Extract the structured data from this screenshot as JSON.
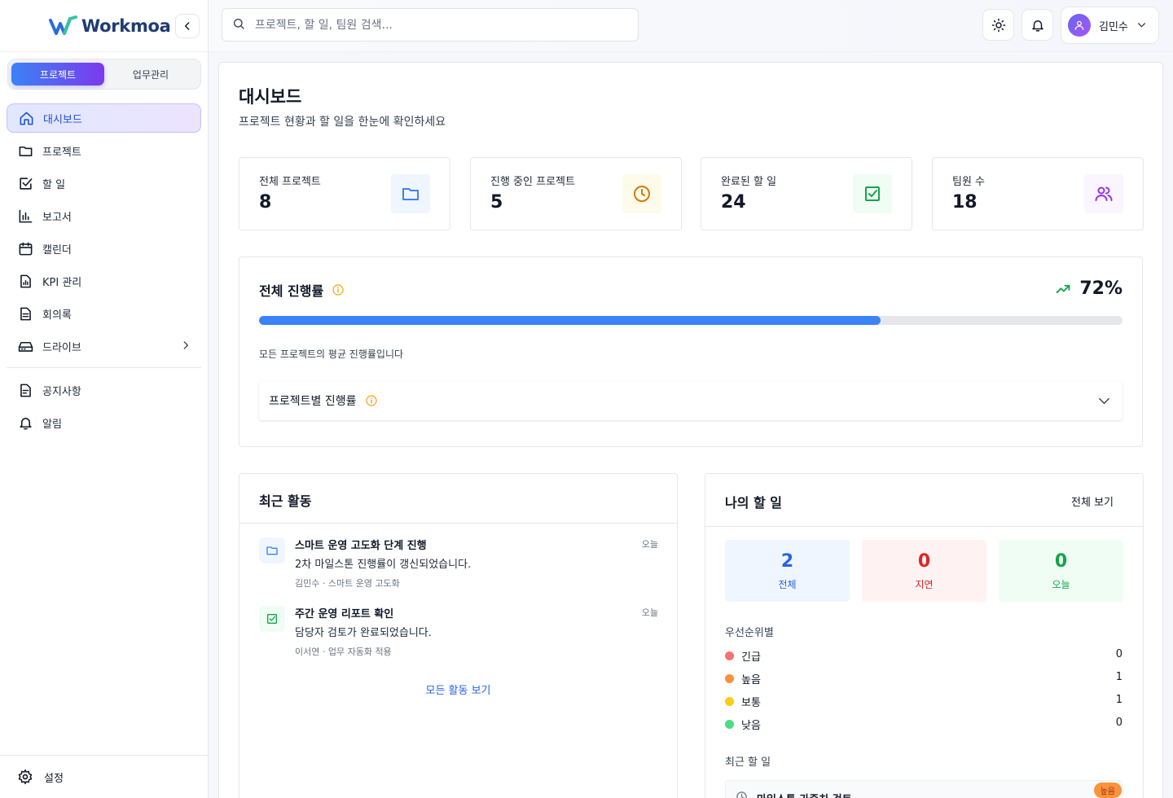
{
  "brand": {
    "name": "Workmoa"
  },
  "mode_toggle": {
    "project": "프로젝트",
    "work": "업무관리"
  },
  "nav": {
    "items": [
      {
        "label": "대시보드",
        "icon": "home-icon"
      },
      {
        "label": "프로젝트",
        "icon": "folder-icon"
      },
      {
        "label": "할 일",
        "icon": "checkbox-icon"
      },
      {
        "label": "보고서",
        "icon": "bar-chart-icon"
      },
      {
        "label": "캘린더",
        "icon": "calendar-icon"
      },
      {
        "label": "KPI 관리",
        "icon": "kpi-file-icon"
      },
      {
        "label": "회의록",
        "icon": "document-icon"
      },
      {
        "label": "드라이브",
        "icon": "drive-icon"
      }
    ],
    "secondary": [
      {
        "label": "공지사항",
        "icon": "notice-icon"
      },
      {
        "label": "알림",
        "icon": "bell-icon"
      }
    ],
    "settings": "설정"
  },
  "topbar": {
    "search_placeholder": "프로젝트, 할 일, 팀원 검색...",
    "user_name": "김민수"
  },
  "page": {
    "title": "대시보드",
    "subtitle": "프로젝트 현황과 할 일을 한눈에 확인하세요"
  },
  "stats": [
    {
      "label": "전체 프로젝트",
      "value": "8",
      "icon": "folder-icon",
      "color": "#3b82f6",
      "bg": "#eff6ff"
    },
    {
      "label": "진행 중인 프로젝트",
      "value": "5",
      "icon": "clock-icon",
      "color": "#d97706",
      "bg": "#fffbeb"
    },
    {
      "label": "완료된 할 일",
      "value": "24",
      "icon": "check-square-icon",
      "color": "#16a34a",
      "bg": "#f0fdf4"
    },
    {
      "label": "팀원 수",
      "value": "18",
      "icon": "users-icon",
      "color": "#9333ea",
      "bg": "#faf5ff"
    }
  ],
  "progress": {
    "title": "전체 진행률",
    "percent_label": "72%",
    "percent": 72,
    "description": "모든 프로젝트의 평균 진행률입니다",
    "accordion_title": "프로젝트별 진행률"
  },
  "activity": {
    "title": "최근 활동",
    "items": [
      {
        "title": "스마트 운영 고도화 단계 진행",
        "desc": "2차 마일스톤 진행률이 갱신되었습니다.",
        "meta": "김민수 · 스마트 운영 고도화",
        "time": "오늘",
        "icon": "folder-icon"
      },
      {
        "title": "주간 운영 리포트 확인",
        "desc": "담당자 검토가 완료되었습니다.",
        "meta": "이서연 · 업무 자동화 적용",
        "time": "오늘",
        "icon": "check-square-icon"
      }
    ],
    "view_all": "모든 활동 보기"
  },
  "todo": {
    "title": "나의 할 일",
    "view_all": "전체 보기",
    "summary": [
      {
        "num": "2",
        "label": "전체",
        "color": "#2563eb",
        "bg": "#eff6ff"
      },
      {
        "num": "0",
        "label": "지연",
        "color": "#dc2626",
        "bg": "#fef2f2"
      },
      {
        "num": "0",
        "label": "오늘",
        "color": "#16a34a",
        "bg": "#f0fdf4"
      }
    ],
    "priority_title": "우선순위별",
    "priorities": [
      {
        "label": "긴급",
        "count": "0",
        "color": "#f87171"
      },
      {
        "label": "높음",
        "count": "1",
        "color": "#fb923c"
      },
      {
        "label": "보통",
        "count": "1",
        "color": "#facc15"
      },
      {
        "label": "낮음",
        "count": "0",
        "color": "#4ade80"
      }
    ],
    "recent_title": "최근 할 일",
    "recent_item": {
      "title": "마일스톤 가중치 검토",
      "badge": "높음"
    }
  }
}
